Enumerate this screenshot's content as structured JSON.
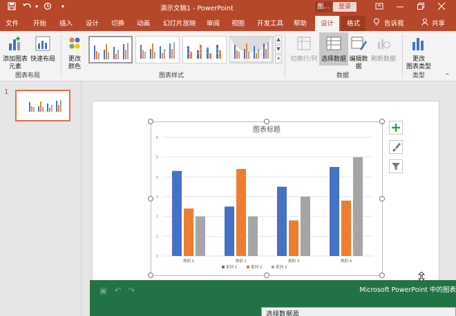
{
  "titlebar": {
    "title": "演示文稿1 - PowerPoint",
    "context_label": "图...",
    "login": "登录"
  },
  "tabs": [
    "文件",
    "开始",
    "插入",
    "设计",
    "切换",
    "动画",
    "幻灯片放映",
    "审阅",
    "视图",
    "开发工具",
    "帮助",
    "设计",
    "格式"
  ],
  "tell_me": "告诉我",
  "share": "共享",
  "ribbon": {
    "add_element": "添加图表\n元素",
    "add_element_l1": "添加图表",
    "add_element_l2": "元素",
    "quick_layout": "快速布局",
    "change_color_l1": "更改",
    "change_color_l2": "颜色",
    "switch_row_col": "切换行/列",
    "select_data": "选择数据",
    "edit_data_l1": "编辑数",
    "edit_data_l2": "据",
    "refresh_data": "刷新数据",
    "change_type_l1": "更改",
    "change_type_l2": "图表类型",
    "group_layout": "图表布局",
    "group_styles": "图表样式",
    "group_data": "数据",
    "group_type": "类型"
  },
  "slide_number": "1",
  "chart_data": {
    "type": "bar",
    "title": "图表标题",
    "categories": [
      "类别 1",
      "类别 2",
      "类别 3",
      "类别 4"
    ],
    "series": [
      {
        "name": "系列 1",
        "color": "#4472c4",
        "values": [
          4.3,
          2.5,
          3.5,
          4.5
        ]
      },
      {
        "name": "系列 2",
        "color": "#ed7d31",
        "values": [
          2.4,
          4.4,
          1.8,
          2.8
        ]
      },
      {
        "name": "系列 3",
        "color": "#a5a5a5",
        "values": [
          2.0,
          2.0,
          3.0,
          5.0
        ]
      }
    ],
    "ylim": [
      0,
      6
    ],
    "yticks": [
      0,
      1,
      2,
      3,
      4,
      5,
      6
    ],
    "grid": true,
    "legend": "bottom"
  },
  "excel": {
    "title": "Microsoft PowerPoint 中的图表"
  },
  "dialog": {
    "title": "选择数据源"
  }
}
